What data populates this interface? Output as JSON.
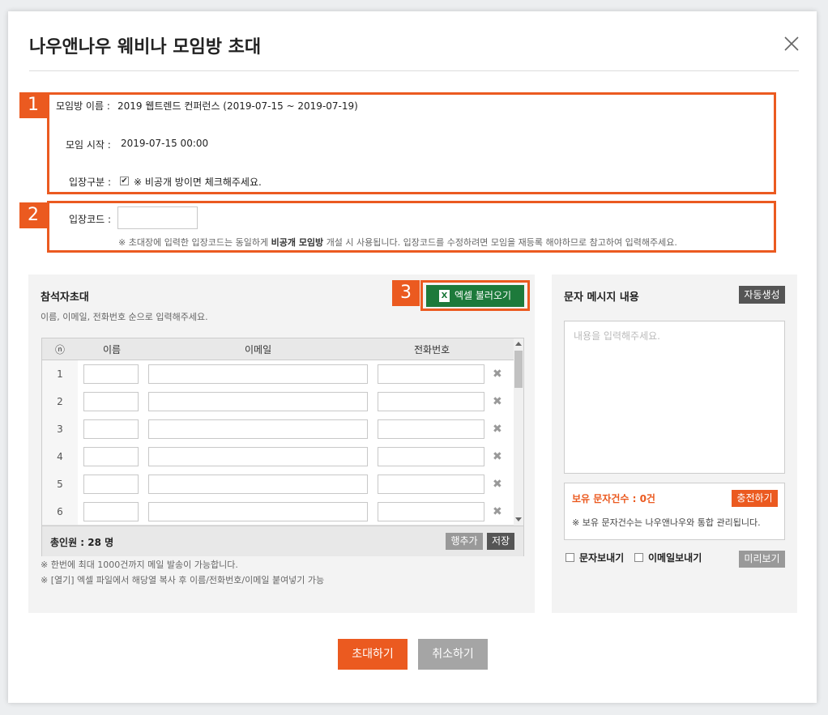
{
  "dialog": {
    "title": "나우앤나우 웨비나 모임방 초대"
  },
  "sections": {
    "n1": "1",
    "n2": "2",
    "n3": "3"
  },
  "info": {
    "room_name_label": "모임방 이름 :",
    "room_name_value": "2019 웹트렌드 컨퍼런스 (2019-07-15 ~ 2019-07-19)",
    "start_label": "모임 시작 :",
    "start_value": "2019-07-15 00:00",
    "entry_label": "입장구분 :",
    "entry_note": "※ 비공개 방이면 체크해주세요.",
    "entry_checked": true
  },
  "code": {
    "label": "입장코드 :",
    "value": "",
    "note_prefix": "※ 초대장에 입력한 입장코드는 동일하게",
    "note_bold": "비공개 모임방",
    "note_suffix": "개설 시 사용됩니다. 입장코드를 수정하려면 모임을 재등록 해야하므로 참고하여 입력해주세요."
  },
  "invite": {
    "title": "참석자초대",
    "hint": "이름, 이메일, 전화번호 순으로 입력해주세요.",
    "excel_button": "엑셀 불러오기",
    "excel_icon": "excel-icon",
    "columns": [
      "ⓝ",
      "이름",
      "이메일",
      "전화번호"
    ],
    "rows": [
      "1",
      "2",
      "3",
      "4",
      "5",
      "6"
    ],
    "total": "총인원 : 28 명",
    "add_row_button": "행추가",
    "save_button": "저장",
    "note1": "※ 한번에 최대 1000건까지 메일 발송이 가능합니다.",
    "note2": "※ [열기] 엑셀 파일에서 해당열 복사 후 이름/전화번호/이메일 붙여넣기 가능"
  },
  "sms": {
    "title": "문자 메시지 내용",
    "auto_button": "자동생성",
    "placeholder": "내용을 입력해주세요.",
    "balance_label": "보유 문자건수 : 0건",
    "charge_button": "충전하기",
    "balance_note": "※ 보유 문자건수는 나우앤나우와 통합 관리됩니다.",
    "send_sms_label": "문자보내기",
    "send_email_label": "이메일보내기",
    "preview_button": "미리보기"
  },
  "footer": {
    "invite_button": "초대하기",
    "cancel_button": "취소하기"
  },
  "colors": {
    "accent": "#eb5a20",
    "excel": "#1d7a3b",
    "dark_button": "#555555"
  }
}
